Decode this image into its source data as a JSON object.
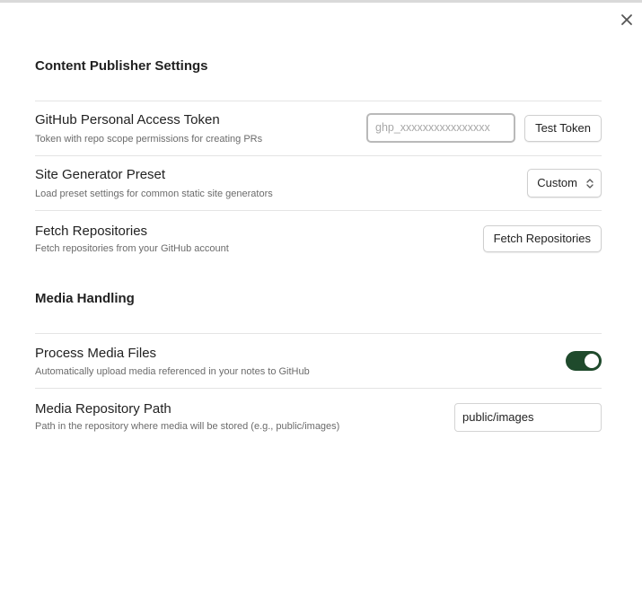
{
  "dialog": {
    "close_icon": "close-icon",
    "title": "Content Publisher Settings"
  },
  "settings": {
    "token": {
      "name": "GitHub Personal Access Token",
      "description": "Token with repo scope permissions for creating PRs",
      "placeholder": "ghp_xxxxxxxxxxxxxxxx",
      "value": "",
      "button_label": "Test Token"
    },
    "preset": {
      "name": "Site Generator Preset",
      "description": "Load preset settings for common static site generators",
      "selected": "Custom",
      "chevron_icon": "chevron-updown-icon"
    },
    "fetch": {
      "name": "Fetch Repositories",
      "description": "Fetch repositories from your GitHub account",
      "button_label": "Fetch Repositories"
    }
  },
  "media": {
    "heading": "Media Handling",
    "process": {
      "name": "Process Media Files",
      "description": "Automatically upload media referenced in your notes to GitHub",
      "enabled": true,
      "accent_color": "#1f4a2c"
    },
    "path": {
      "name": "Media Repository Path",
      "description": "Path in the repository where media will be stored (e.g., public/images)",
      "value": "public/images"
    }
  }
}
